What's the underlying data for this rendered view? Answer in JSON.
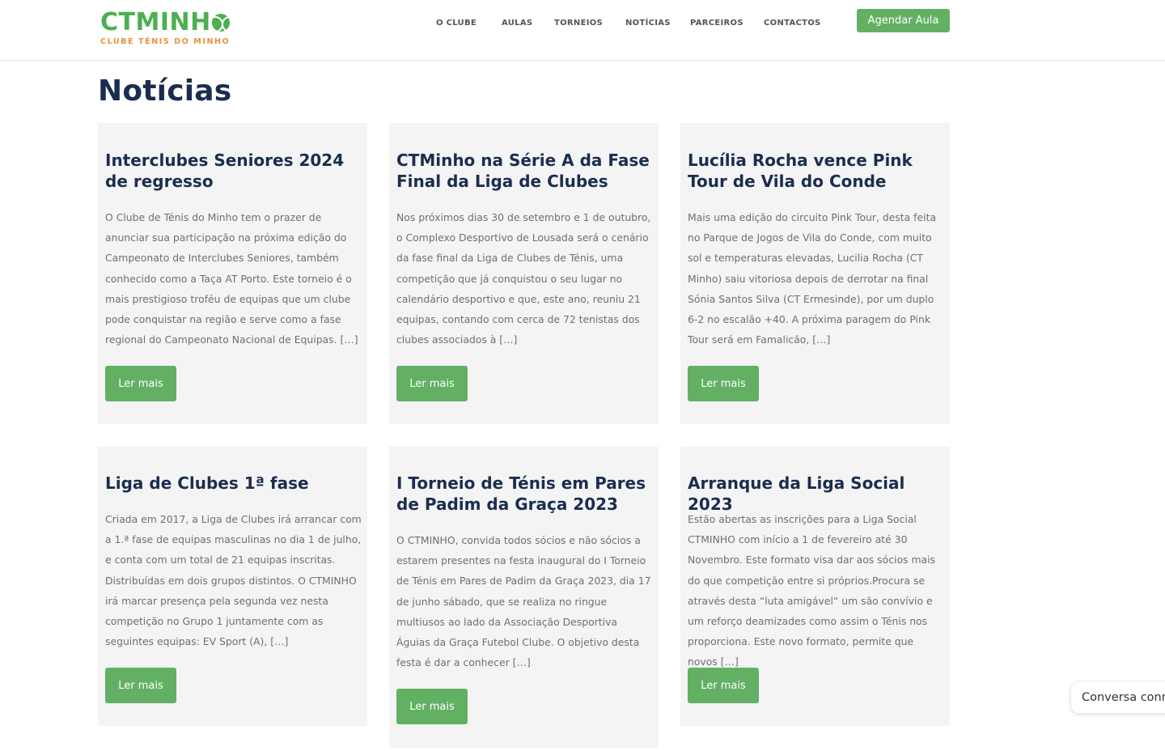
{
  "brand": {
    "name_prefix": "CTMINH",
    "tagline": "CLUBE TÉNIS DO MINHO",
    "primary_color": "#4caf50",
    "accent_color": "#e8913a",
    "logo_icon": "tennis-ball-icon"
  },
  "nav": {
    "items": [
      {
        "label": "O CLUBE"
      },
      {
        "label": "AULAS"
      },
      {
        "label": "TORNEIOS"
      },
      {
        "label": "NOTÍCIAS"
      },
      {
        "label": "PARCEIROS"
      },
      {
        "label": "CONTACTOS"
      }
    ],
    "cta_label": "Agendar Aula"
  },
  "page": {
    "title": "Notícias"
  },
  "posts": [
    {
      "title": "Interclubes Seniores 2024 de regresso",
      "excerpt": "O Clube de Ténis do Minho tem o prazer de anunciar sua participação na próxima edição do Campeonato de Interclubes Seniores, também conhecido como a Taça AT Porto. Este torneio é o mais prestigioso troféu de equipas que um clube pode conquistar na região e serve como a fase regional do Campeonato Nacional de Equipas. […]",
      "button": "Ler mais"
    },
    {
      "title": "CTMinho na Série A da Fase Final da Liga de Clubes",
      "excerpt": "Nos próximos dias 30 de setembro e 1 de outubro, o Complexo Desportivo de Lousada será o cenário da fase final da Liga de Clubes de Ténis, uma competição que já conquistou o seu lugar no calendário desportivo e que, este ano, reuniu 21 equipas, contando com cerca de 72 tenistas dos clubes associados à […]",
      "button": "Ler mais"
    },
    {
      "title": "Lucília Rocha vence Pink Tour de Vila do Conde",
      "excerpt": "Mais uma edição do circuito Pink Tour, desta feita no Parque de Jogos de Vila do Conde, com muito sol e temperaturas elevadas, Lucilia Rocha (CT Minho) saiu vitoriosa depois de derrotar na final Sónia Santos Silva (CT Ermesinde), por um duplo 6-2 no escalão +40. A próxima paragem do Pink Tour será em Famalicão, […]",
      "button": "Ler mais"
    },
    {
      "title": "Liga de Clubes 1ª fase",
      "excerpt": "Criada em 2017, a Liga de Clubes irá arrancar com a 1.ª fase de equipas masculinas no dia 1 de julho, e conta com um total de 21 equipas inscritas. Distribuídas em dois grupos distintos. O CTMINHO irá marcar presença pela segunda vez nesta competição no Grupo 1 juntamente com as seguintes equipas: EV Sport (A), […]",
      "button": "Ler mais"
    },
    {
      "title": "I Torneio de Ténis em Pares de Padim da Graça 2023",
      "excerpt": "O CTMINHO, convida todos sócios e não sócios a estarem presentes na festa inaugural do I Torneio de Ténis em Pares de Padim da Graça 2023, dia 17 de junho sábado, que se realiza no ringue multiusos ao lado da Associação Desportiva Águias da Graça Futebol Clube. O objetivo desta festa é dar a conhecer […]",
      "button": "Ler mais"
    },
    {
      "title": "Arranque da Liga Social 2023",
      "excerpt": "Estão abertas as inscrições para a Liga Social CTMINHO com início a 1 de fevereiro até 30 Novembro. Este formato visa dar aos sócios mais do que competição entre si próprios.Procura se através desta “luta amigável“ um são convívio e um reforço deamizades como assim o Ténis nos proporciona. Este novo formato, permite que novos […]",
      "button": "Ler mais"
    }
  ],
  "chat": {
    "label": "Conversa connosco"
  }
}
